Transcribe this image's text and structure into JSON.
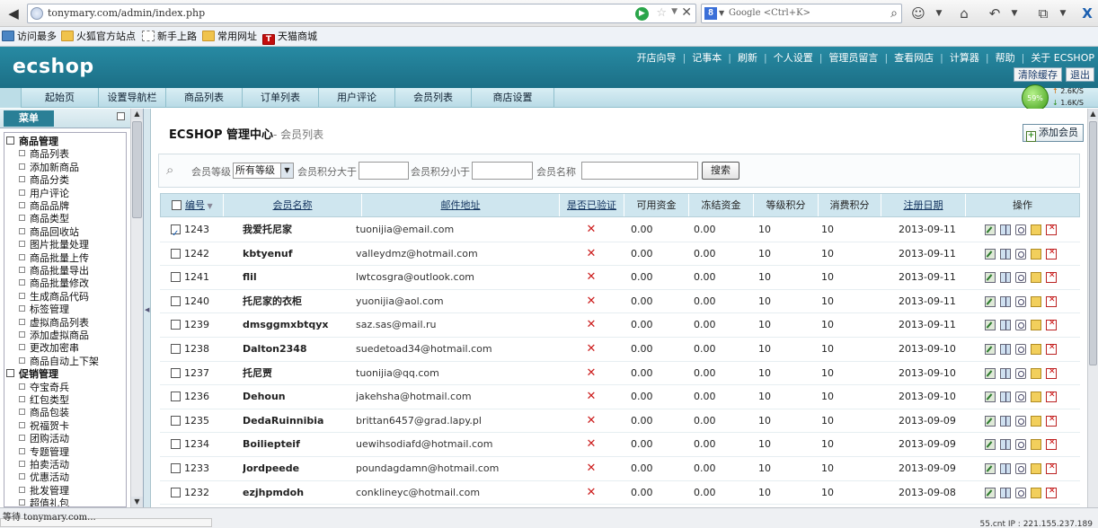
{
  "browser": {
    "url": "tonymary.com/admin/index.php",
    "search_placeholder": "Google <Ctrl+K>",
    "google_letter": "8",
    "status": "等待 tonymary.com...",
    "status_right": "55.cnt  IP : 221.155.237.189"
  },
  "bookmarks": [
    {
      "label": "访问最多",
      "icon": "bookmark-icon"
    },
    {
      "label": "火狐官方站点",
      "icon": "folder-icon"
    },
    {
      "label": "新手上路",
      "icon": "page-icon"
    },
    {
      "label": "常用网址",
      "icon": "folder-icon"
    },
    {
      "label": "天猫商城",
      "icon": "tmall-icon"
    }
  ],
  "tmall_letter": "T",
  "header": {
    "logo": "ecshop",
    "links": [
      "开店向导",
      "记事本",
      "刷新",
      "个人设置",
      "管理员留言",
      "查看网店",
      "计算器",
      "帮助",
      "关于 ECSHOP"
    ],
    "clear_cache": "清除缓存",
    "logout": "退出"
  },
  "tabs": [
    "起始页",
    "设置导航栏",
    "商品列表",
    "订单列表",
    "用户评论",
    "会员列表",
    "商店设置"
  ],
  "network": {
    "percent": "59%",
    "up": "2.6K/S",
    "down": "1.6K/S"
  },
  "menu": {
    "title": "菜单",
    "items": [
      {
        "label": "商品管理",
        "group": true
      },
      {
        "label": "商品列表",
        "group": false
      },
      {
        "label": "添加新商品",
        "group": false
      },
      {
        "label": "商品分类",
        "group": false
      },
      {
        "label": "用户评论",
        "group": false
      },
      {
        "label": "商品品牌",
        "group": false
      },
      {
        "label": "商品类型",
        "group": false
      },
      {
        "label": "商品回收站",
        "group": false
      },
      {
        "label": "图片批量处理",
        "group": false
      },
      {
        "label": "商品批量上传",
        "group": false
      },
      {
        "label": "商品批量导出",
        "group": false
      },
      {
        "label": "商品批量修改",
        "group": false
      },
      {
        "label": "生成商品代码",
        "group": false
      },
      {
        "label": "标签管理",
        "group": false
      },
      {
        "label": "虚拟商品列表",
        "group": false
      },
      {
        "label": "添加虚拟商品",
        "group": false
      },
      {
        "label": "更改加密串",
        "group": false
      },
      {
        "label": "商品自动上下架",
        "group": false
      },
      {
        "label": "促销管理",
        "group": true
      },
      {
        "label": "夺宝奇兵",
        "group": false
      },
      {
        "label": "红包类型",
        "group": false
      },
      {
        "label": "商品包装",
        "group": false
      },
      {
        "label": "祝福贺卡",
        "group": false
      },
      {
        "label": "团购活动",
        "group": false
      },
      {
        "label": "专题管理",
        "group": false
      },
      {
        "label": "拍卖活动",
        "group": false
      },
      {
        "label": "优惠活动",
        "group": false
      },
      {
        "label": "批发管理",
        "group": false
      },
      {
        "label": "超值礼包",
        "group": false
      }
    ]
  },
  "page": {
    "title": "ECSHOP 管理中心",
    "subtitle": "- 会员列表",
    "add_button": "添加会员"
  },
  "filter": {
    "rank_label": "会员等级",
    "rank_value": "所有等级",
    "points_gt_label": "会员积分大于",
    "points_lt_label": "会员积分小于",
    "name_label": "会员名称",
    "search_button": "搜索"
  },
  "table": {
    "columns": [
      "编号",
      "会员名称",
      "邮件地址",
      "是否已验证",
      "可用资金",
      "冻结资金",
      "等级积分",
      "消费积分",
      "注册日期",
      "操作"
    ],
    "rows": [
      {
        "id": "1243",
        "name": "我爱托尼家",
        "email": "tuonijia@email.com",
        "verified": "✕",
        "funds": "0.00",
        "frozen": "0.00",
        "rank_points": "10",
        "pay_points": "10",
        "date": "2013-09-11",
        "checked": true
      },
      {
        "id": "1242",
        "name": "kbtyenuf",
        "email": "valleydmz@hotmail.com",
        "verified": "✕",
        "funds": "0.00",
        "frozen": "0.00",
        "rank_points": "10",
        "pay_points": "10",
        "date": "2013-09-11",
        "checked": false
      },
      {
        "id": "1241",
        "name": "flil",
        "email": "lwtcosgra@outlook.com",
        "verified": "✕",
        "funds": "0.00",
        "frozen": "0.00",
        "rank_points": "10",
        "pay_points": "10",
        "date": "2013-09-11",
        "checked": false
      },
      {
        "id": "1240",
        "name": "托尼家的衣柜",
        "email": "yuonijia@aol.com",
        "verified": "✕",
        "funds": "0.00",
        "frozen": "0.00",
        "rank_points": "10",
        "pay_points": "10",
        "date": "2013-09-11",
        "checked": false
      },
      {
        "id": "1239",
        "name": "dmsggmxbtqyx",
        "email": "saz.sas@mail.ru",
        "verified": "✕",
        "funds": "0.00",
        "frozen": "0.00",
        "rank_points": "10",
        "pay_points": "10",
        "date": "2013-09-11",
        "checked": false
      },
      {
        "id": "1238",
        "name": "Dalton2348",
        "email": "suedetoad34@hotmail.com",
        "verified": "✕",
        "funds": "0.00",
        "frozen": "0.00",
        "rank_points": "10",
        "pay_points": "10",
        "date": "2013-09-10",
        "checked": false
      },
      {
        "id": "1237",
        "name": "托尼贾",
        "email": "tuonijia@qq.com",
        "verified": "✕",
        "funds": "0.00",
        "frozen": "0.00",
        "rank_points": "10",
        "pay_points": "10",
        "date": "2013-09-10",
        "checked": false
      },
      {
        "id": "1236",
        "name": "Dehoun",
        "email": "jakehsha@hotmail.com",
        "verified": "✕",
        "funds": "0.00",
        "frozen": "0.00",
        "rank_points": "10",
        "pay_points": "10",
        "date": "2013-09-10",
        "checked": false
      },
      {
        "id": "1235",
        "name": "DedaRuinnibia",
        "email": "brittan6457@grad.lapy.pl",
        "verified": "✕",
        "funds": "0.00",
        "frozen": "0.00",
        "rank_points": "10",
        "pay_points": "10",
        "date": "2013-09-09",
        "checked": false
      },
      {
        "id": "1234",
        "name": "Boiliepteif",
        "email": "uewihsodiafd@hotmail.com",
        "verified": "✕",
        "funds": "0.00",
        "frozen": "0.00",
        "rank_points": "10",
        "pay_points": "10",
        "date": "2013-09-09",
        "checked": false
      },
      {
        "id": "1233",
        "name": "Jordpeede",
        "email": "poundagdamn@hotmail.com",
        "verified": "✕",
        "funds": "0.00",
        "frozen": "0.00",
        "rank_points": "10",
        "pay_points": "10",
        "date": "2013-09-09",
        "checked": false
      },
      {
        "id": "1232",
        "name": "ezjhpmdoh",
        "email": "conklineyc@hotmail.com",
        "verified": "✕",
        "funds": "0.00",
        "frozen": "0.00",
        "rank_points": "10",
        "pay_points": "10",
        "date": "2013-09-08",
        "checked": false
      }
    ]
  },
  "colors": {
    "header": "#1f7a92",
    "tabbar": "#c7e3ec",
    "table_head": "#cfe6ef",
    "cross": "#cc1d1d"
  }
}
